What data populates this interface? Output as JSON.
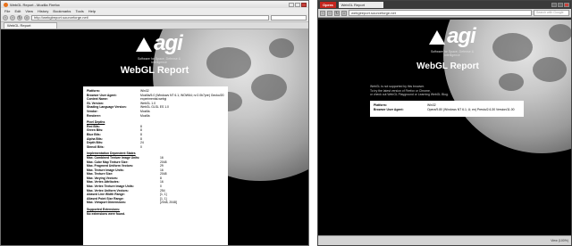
{
  "firefox": {
    "title": "WebGL Report - Mozilla Firefox",
    "menu": [
      "File",
      "Edit",
      "View",
      "History",
      "Bookmarks",
      "Tools",
      "Help"
    ],
    "url": "http://webglreport.sourceforge.net/",
    "tab": "WebGL Report"
  },
  "opera": {
    "menu_button": "Opera",
    "tab": "WebGL Report",
    "url": "webglreport.sourceforge.net",
    "search_placeholder": "Search with Google",
    "status_left": "",
    "zoom": "View (100%)"
  },
  "logo": {
    "word": "agi",
    "tagline": "Software for Space, Defense & Intelligence"
  },
  "report_title": "WebGL Report",
  "firefox_report": {
    "rows": [
      {
        "k": "Platform:",
        "v": "Win32"
      },
      {
        "k": "Browser User Agent:",
        "v": "Mozilla/5.0 (Windows NT 6.1; WOW64; rv:2.0b7pre) Gecko/20100924 Firefox/4.0b7pre"
      },
      {
        "k": "Context Name:",
        "v": "experimental-webgl"
      },
      {
        "k": "GL Version:",
        "v": "WebGL 1.0"
      },
      {
        "k": "Shading Language Version:",
        "v": "WebGL GLSL ES 1.0"
      },
      {
        "k": "Vendor:",
        "v": "Mozilla"
      },
      {
        "k": "Renderer:",
        "v": "Mozilla"
      }
    ],
    "pixel_title": "Pixel Depths",
    "pixel_rows": [
      {
        "k": "Red Bits:",
        "v": "8"
      },
      {
        "k": "Green Bits:",
        "v": "8"
      },
      {
        "k": "Blue Bits:",
        "v": "8"
      },
      {
        "k": "Alpha Bits:",
        "v": "8"
      },
      {
        "k": "Depth Bits:",
        "v": "24"
      },
      {
        "k": "Stencil Bits:",
        "v": "0"
      }
    ],
    "impl_title": "Implementation Dependent States",
    "impl_rows": [
      {
        "k": "Max. Combined Texture Image Units:",
        "v": "16"
      },
      {
        "k": "Max. Cube Map Texture Size:",
        "v": "2048"
      },
      {
        "k": "Max. Fragment Uniform Vectors:",
        "v": "29"
      },
      {
        "k": "Max. Texture Image Units:",
        "v": "16"
      },
      {
        "k": "Max. Texture Size:",
        "v": "2048"
      },
      {
        "k": "Max. Varying Vectors:",
        "v": "8"
      },
      {
        "k": "Max. Vertex Attributes:",
        "v": "16"
      },
      {
        "k": "Max. Vertex Texture Image Units:",
        "v": "0"
      },
      {
        "k": "Max. Vertex Uniform Vectors:",
        "v": "254"
      },
      {
        "k": "Aliased Line Width Range:",
        "v": "[1, 1]"
      },
      {
        "k": "Aliased Point Size Range:",
        "v": "[1, 1]"
      },
      {
        "k": "Max. Viewport Dimensions:",
        "v": "[2048, 2048]"
      }
    ],
    "ext_title": "Supported Extensions:",
    "ext_value": "No extensions were found."
  },
  "opera_report": {
    "notice": [
      "WebGL is not supported by this browser.",
      "To try the latest version of Firefox or Chrome,",
      "or check out WebGL Playground or Learning WebGL Blog."
    ],
    "links": [
      "Firefox",
      "Chrome"
    ],
    "rows": [
      {
        "k": "Platform:",
        "v": "Win32"
      },
      {
        "k": "Browser User Agent:",
        "v": "Opera/9.80 (Windows NT 6.1; U; en) Presto/2.6.30 Version/11.00"
      }
    ]
  }
}
